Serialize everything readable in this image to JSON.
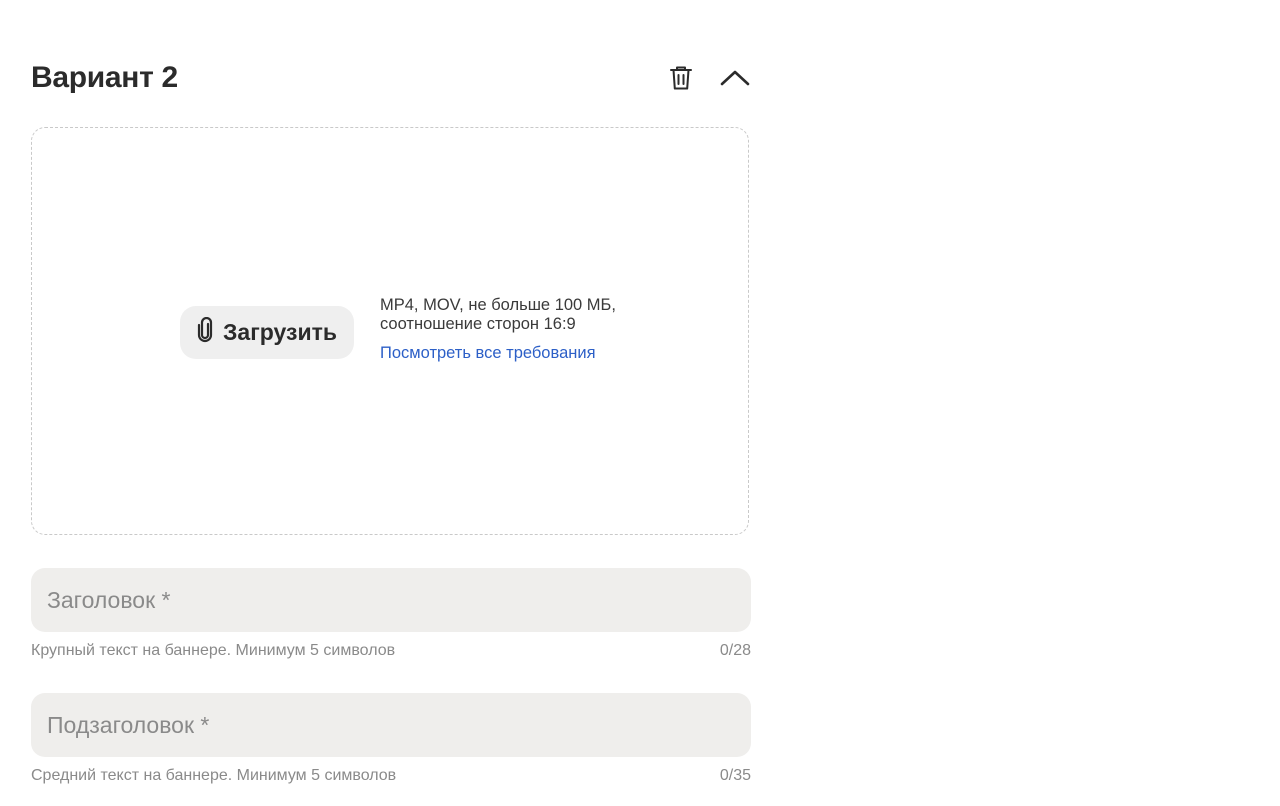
{
  "variant": {
    "title": "Вариант 2",
    "actions": {
      "delete_icon": "trash-icon",
      "collapse_icon": "chevron-up-icon"
    }
  },
  "upload": {
    "button_label": "Загрузить",
    "button_icon": "paperclip-icon",
    "format_line1": "MP4, MOV, не больше 100 МБ,",
    "format_line2": "соотношение сторон 16:9",
    "requirements_link": "Посмотреть все требования"
  },
  "fields": {
    "title": {
      "placeholder": "Заголовок *",
      "value": "",
      "hint": "Крупный текст на баннере. Минимум 5 символов",
      "counter": "0/28"
    },
    "subtitle": {
      "placeholder": "Подзаголовок *",
      "value": "",
      "hint": "Средний текст на баннере. Минимум 5 символов",
      "counter": "0/35"
    }
  },
  "colors": {
    "link": "#2c5fc7",
    "field_bg": "#efeeec",
    "button_bg": "#efefef",
    "hint_text": "#8a8a8a",
    "dashed_border": "#c9c9c9"
  }
}
